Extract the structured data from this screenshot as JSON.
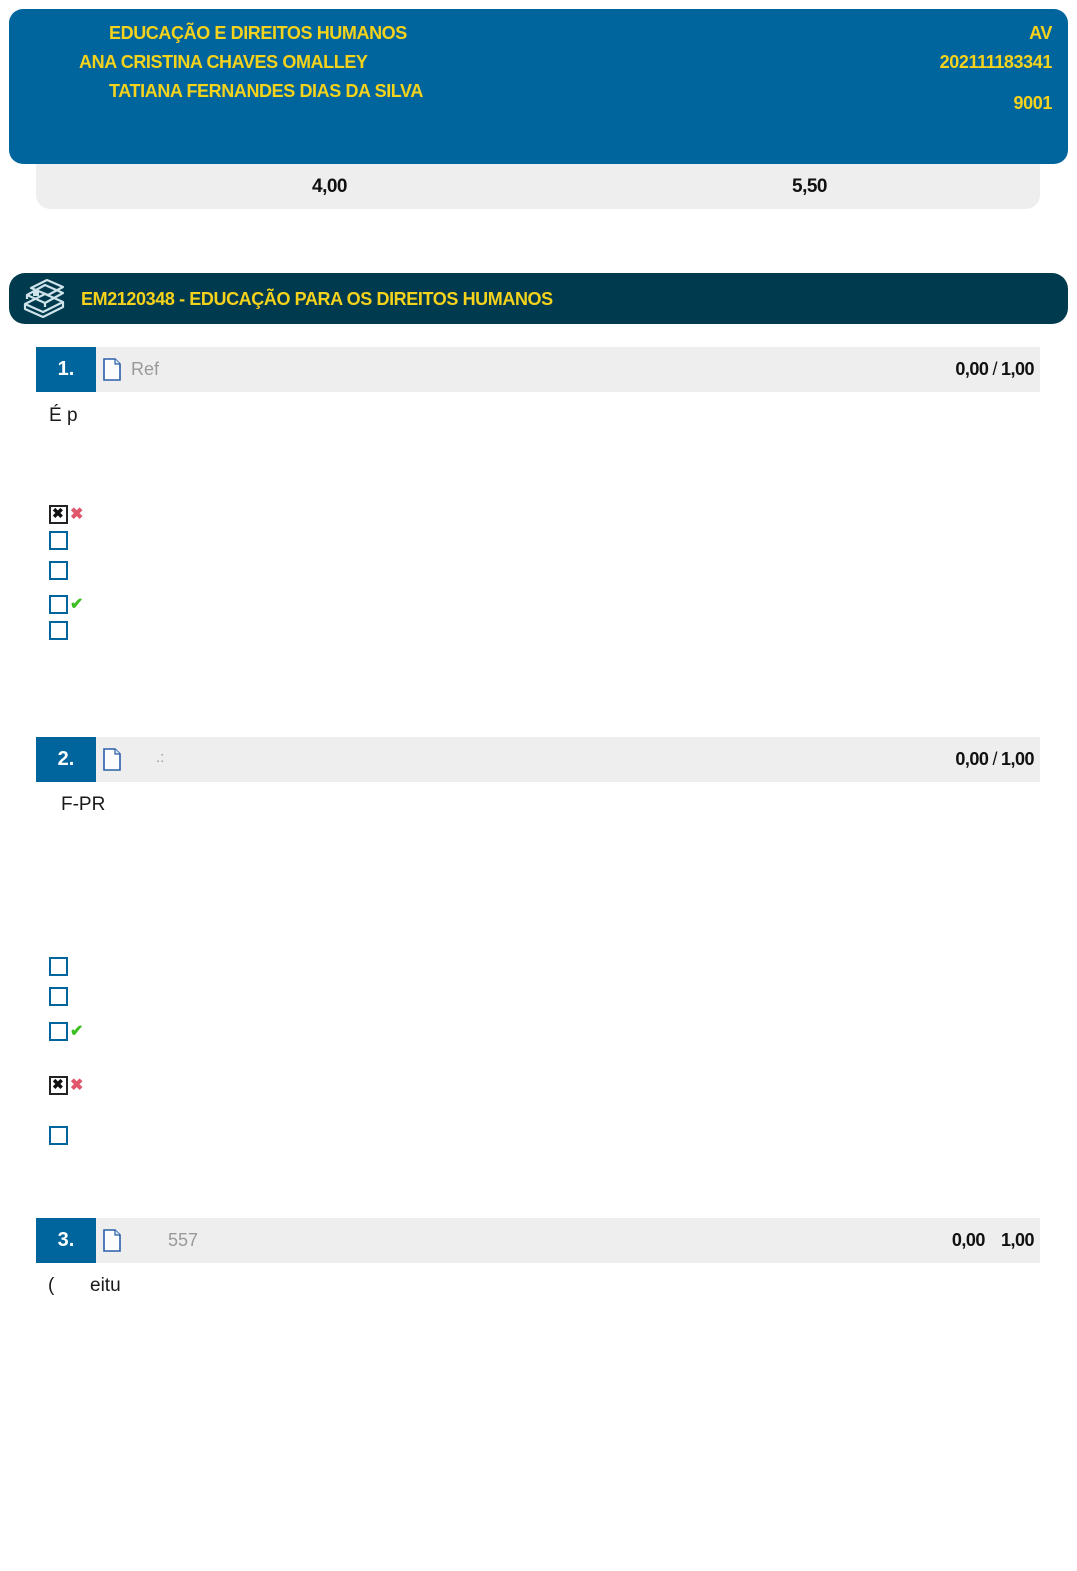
{
  "header": {
    "course_name": "EDUCAÇÃO E DIREITOS HUMANOS",
    "student_name": "ANA CRISTINA CHAVES OMALLEY",
    "teacher_name": "TATIANA FERNANDES DIAS DA SILVA",
    "exam_type": "AV",
    "registration": "202111183341",
    "class_code": "9001"
  },
  "grades": {
    "grade_left": "4,00",
    "grade_right": "5,50"
  },
  "course": {
    "icon": "books-icon",
    "title": "EM2120348 - EDUCAÇÃO PARA OS DIREITOS HUMANOS"
  },
  "questions": [
    {
      "number": "1.",
      "ref": "Ref",
      "score": "0,00",
      "separator": "/",
      "max": "1,00",
      "text": "É p",
      "options": [
        {
          "checked": true,
          "mark": "wrong"
        },
        {
          "checked": false,
          "mark": ""
        },
        {
          "checked": false,
          "mark": ""
        },
        {
          "checked": false,
          "mark": "right"
        },
        {
          "checked": false,
          "mark": ""
        }
      ]
    },
    {
      "number": "2.",
      "ref": ".:",
      "score": "0,00",
      "separator": "/",
      "max": "1,00",
      "text": "F-PR",
      "options": [
        {
          "checked": false,
          "mark": ""
        },
        {
          "checked": false,
          "mark": ""
        },
        {
          "checked": false,
          "mark": "right"
        },
        {
          "checked": true,
          "mark": "wrong"
        },
        {
          "checked": false,
          "mark": ""
        }
      ]
    },
    {
      "number": "3.",
      "ref": "557",
      "score": "0,00",
      "separator": "",
      "max": "1,00",
      "text_a": "(",
      "text_b": "eitu"
    }
  ],
  "colors": {
    "header_bg": "#00659c",
    "course_bg": "#003a4e",
    "accent_text": "#f5d21c",
    "wrong_mark": "#e0566b",
    "right_mark": "#3cbf20"
  }
}
